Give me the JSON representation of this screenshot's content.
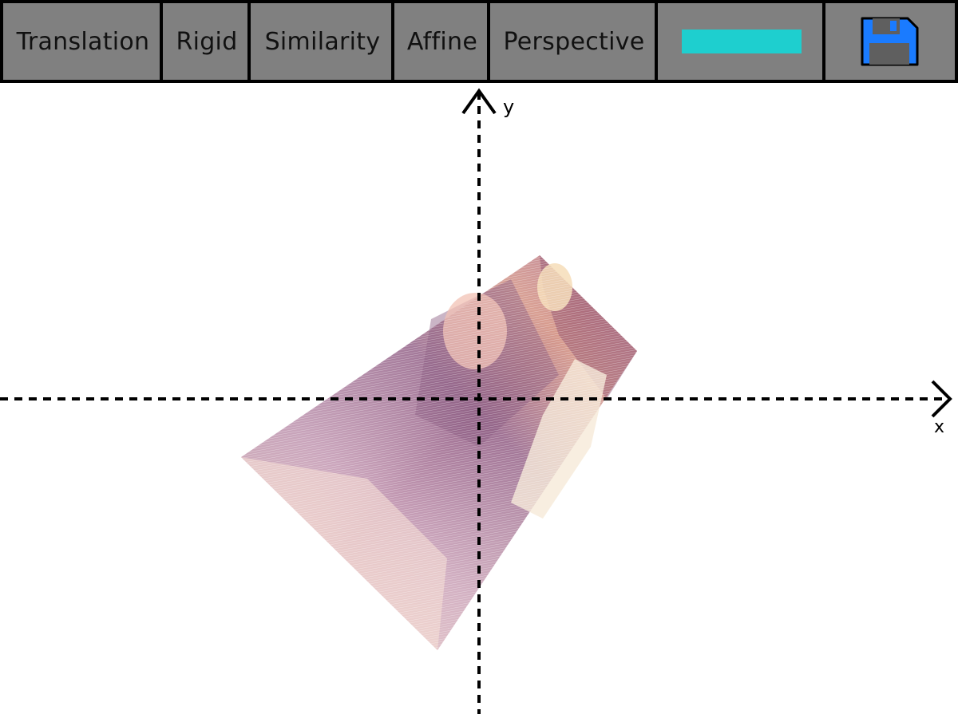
{
  "toolbar": {
    "items": [
      {
        "label": "Translation"
      },
      {
        "label": "Rigid"
      },
      {
        "label": "Similarity"
      },
      {
        "label": "Affine"
      },
      {
        "label": "Perspective"
      }
    ],
    "color_swatch": "#1ecfcf",
    "save_icon": "floppy-disk-icon",
    "save_icon_color": "#1a7bff"
  },
  "axes": {
    "x_label": "x",
    "y_label": "y"
  },
  "image": {
    "description_icon": "warped-photo"
  }
}
